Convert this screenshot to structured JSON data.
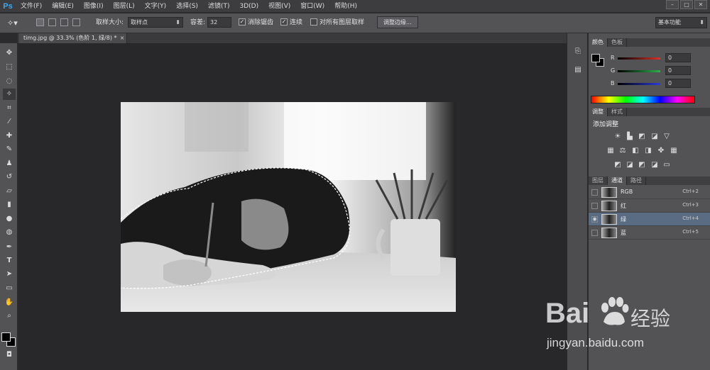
{
  "app": {
    "logo": "Ps"
  },
  "menu": [
    "文件(F)",
    "编辑(E)",
    "图像(I)",
    "图层(L)",
    "文字(Y)",
    "选择(S)",
    "滤镜(T)",
    "3D(D)",
    "视图(V)",
    "窗口(W)",
    "帮助(H)"
  ],
  "window_controls": [
    "–",
    "□",
    "✕"
  ],
  "options": {
    "sample_size_label": "取样大小:",
    "sample_size_value": "取样点",
    "tolerance_label": "容差:",
    "tolerance_value": "32",
    "antialias_label": "消除锯齿",
    "contiguous_label": "连续",
    "sample_all_label": "对所有图层取样",
    "refine_edge_label": "调整边缘...",
    "workspace_value": "基本功能"
  },
  "document": {
    "tab_title": "timg.jpg @ 33.3% (色阶 1, 绿/8) *",
    "close": "×"
  },
  "color_panel": {
    "tabs": [
      "颜色",
      "色板"
    ],
    "sliders": [
      {
        "label": "R",
        "value": "0",
        "color": "#d9302a"
      },
      {
        "label": "G",
        "value": "0",
        "color": "#2bb24c"
      },
      {
        "label": "B",
        "value": "0",
        "color": "#2a3ad9"
      }
    ]
  },
  "adjust_panel": {
    "tabs": [
      "调整",
      "样式"
    ],
    "title": "添加调整"
  },
  "channels_panel": {
    "tabs": [
      "图层",
      "通道",
      "路径"
    ],
    "rows": [
      {
        "name": "RGB",
        "shortcut": "Ctrl+2",
        "visible": false
      },
      {
        "name": "红",
        "shortcut": "Ctrl+3",
        "visible": false
      },
      {
        "name": "绿",
        "shortcut": "Ctrl+4",
        "visible": true
      },
      {
        "name": "蓝",
        "shortcut": "Ctrl+5",
        "visible": false
      }
    ]
  },
  "watermark": {
    "brand": "Bai",
    "brand2": "经验",
    "url": "jingyan.baidu.com"
  }
}
